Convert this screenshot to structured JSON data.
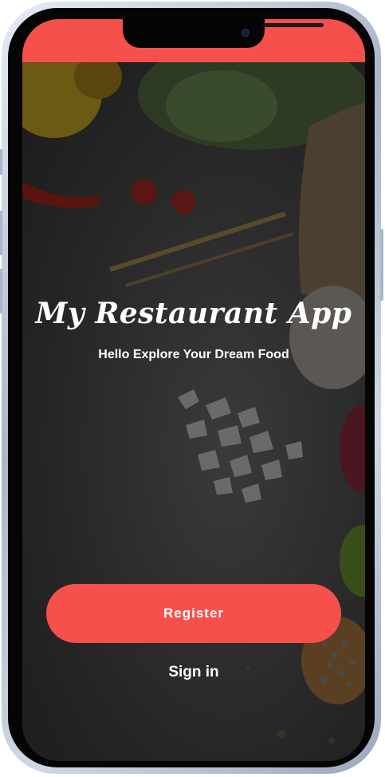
{
  "app": {
    "title": "My Restaurant App",
    "subtitle": "Hello Explore Your Dream Food"
  },
  "actions": {
    "register_label": "Register",
    "signin_label": "Sign in"
  },
  "colors": {
    "accent": "#f5504c",
    "text": "#ffffff",
    "background": "#2b2b2b"
  },
  "icons": {
    "background_image": "food-ingredients-background"
  }
}
